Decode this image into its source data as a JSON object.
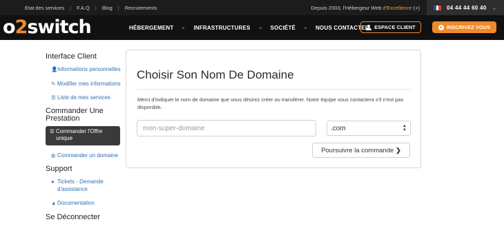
{
  "topbar": {
    "links": [
      "Etat des services",
      "F.A.Q",
      "Blog",
      "Recrutements"
    ],
    "tagline_prefix": "Depuis 2003, l'Hébergeur Web ",
    "tagline_highlight": "d'Excellence",
    "tagline_suffix": " (+)",
    "phone": "04 44 44 60 40",
    "chevron": "⌄"
  },
  "nav": {
    "logo_left": "o",
    "logo_mid": "2",
    "logo_right": "switch",
    "items": [
      "HÉBERGEMENT",
      "INFRASTRUCTURES",
      "SOCIÉTÉ",
      "NOUS CONTACTER"
    ],
    "espace_client": "ESPACE CLIENT",
    "inscrivez": "INSCRIVEZ VOUS"
  },
  "sidebar": {
    "sections": [
      {
        "heading": "Interface Client",
        "items": [
          {
            "icon": "user-icon",
            "glyph": "👤",
            "label": "Informations personnelles"
          },
          {
            "icon": "pencil-icon",
            "glyph": "✎",
            "label": "Modifier mes informations"
          },
          {
            "icon": "list-icon",
            "glyph": "☰",
            "label": "Liste de mes services"
          }
        ]
      },
      {
        "heading": "Commander Une Prestation",
        "items": [
          {
            "icon": "list-icon",
            "glyph": "☰",
            "label": "Commander l'Offre unique",
            "active": true
          },
          {
            "icon": "globe-icon",
            "glyph": "◍",
            "label": "Commander un domaine"
          }
        ]
      },
      {
        "heading": "Support",
        "items": [
          {
            "icon": "ticket-icon",
            "glyph": "●",
            "label": "Tickets - Demande d'assistance"
          },
          {
            "icon": "graduation-cap-icon",
            "glyph": "▲",
            "label": "Documentation"
          }
        ]
      },
      {
        "heading": "Se Déconnecter",
        "items": []
      }
    ]
  },
  "panel": {
    "title": "Choisir Son Nom De Domaine",
    "description": "Merci d'indiquer le nom de domaine que vous désirez créer ou transférer. Notre équipe vous contactera s'il n'est pas disponible.",
    "domain_placeholder": "mon-super-domaine",
    "tld_selected": ".com",
    "submit_label": "Poursuivre la commande"
  },
  "colors": {
    "accent": "#f08a2a",
    "link": "#2f6faf",
    "topbar_bg": "#1c1c1c",
    "nav_bg": "#111111"
  }
}
